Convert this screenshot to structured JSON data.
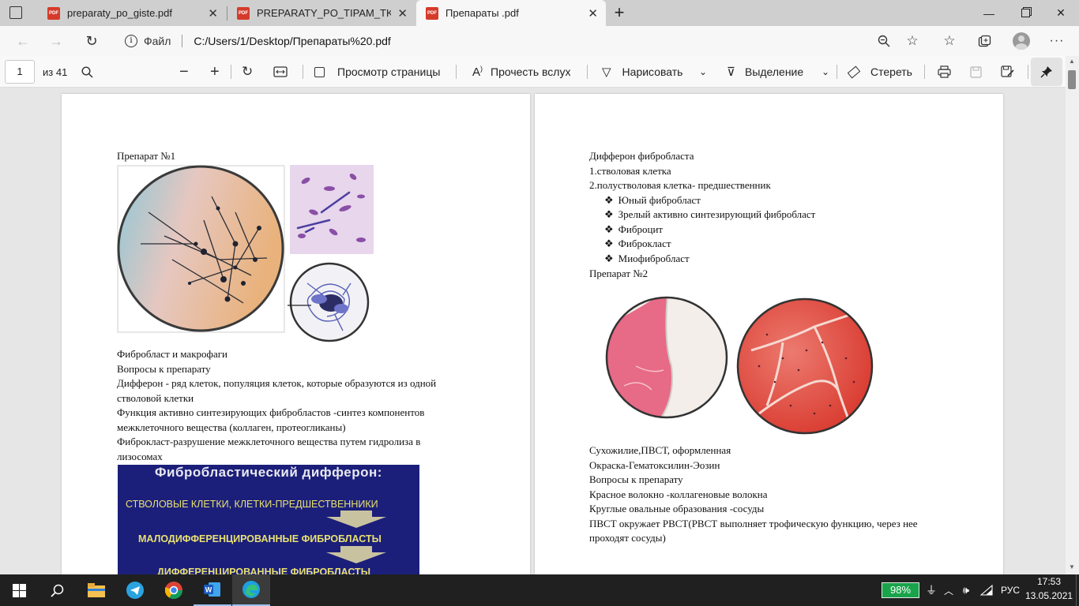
{
  "browser": {
    "tabs": [
      {
        "title": "preparaty_po_giste.pdf",
        "active": false
      },
      {
        "title": "PREPARATY_PO_TIPAM_TKANEJ (",
        "active": false
      },
      {
        "title": "Препараты .pdf",
        "active": true
      }
    ],
    "pdf_badge": "PDF",
    "new_tab": "+",
    "address": {
      "scheme_label": "Файл",
      "url": "C:/Users/1/Desktop/Препараты%20.pdf"
    }
  },
  "pdf_toolbar": {
    "page_current": "1",
    "page_total": "из 41",
    "page_view": "Просмотр страницы",
    "read_aloud": "Прочесть вслух",
    "draw": "Нарисовать",
    "highlight": "Выделение",
    "erase": "Стереть"
  },
  "left_page": {
    "heading": "Препарат №1",
    "caption": "Фибробласт и макрофаги",
    "lines": [
      "Вопросы к препарату",
      "Дифферон - ряд клеток, популяция клеток, которые образуются из одной",
      "стволовой клетки",
      "Функция активно синтезирующих фибробластов -синтез компонентов",
      "межклеточного вещества (коллаген, протеогликаны)",
      "Фиброкласт-разрушение межклеточного вещества путем гидролиза в",
      "лизосомах"
    ],
    "slide": {
      "title": "Фибробластический  дифферон:",
      "row1": "СТВОЛОВЫЕ КЛЕТКИ, КЛЕТКИ-ПРЕДШЕСТВЕННИКИ",
      "row2": "МАЛОДИФФЕРЕНЦИРОВАННЫЕ  ФИБРОБЛАСТЫ",
      "row3": "ДИФФЕРЕНЦИРОВАННЫЕ ФИБРОБЛАСТЫ"
    }
  },
  "right_page": {
    "lines_top": [
      "Дифферон фибробласта",
      "1.стволовая клетка",
      "2.полустволовая клетка- предшественник"
    ],
    "bullet_glyph": "❖",
    "bullets": [
      "Юный фибробласт",
      "Зрелый активно синтезирующий фибробласт",
      "Фиброцит",
      "Фиброкласт",
      "Миофибробласт"
    ],
    "heading2": "Препарат №2",
    "lines_bottom": [
      "Сухожилие,ПВСТ, оформленная",
      "Окраска-Гематоксилин-Эозин",
      "Вопросы к препарату",
      "Красное волокно -коллагеновые волокна",
      "Круглые овальные образования -сосуды",
      "ПВСТ окружает РВСТ(РВСТ выполняет трофическую функцию, через нее",
      "проходят сосуды)"
    ]
  },
  "taskbar": {
    "battery": "98%",
    "language": "РУС",
    "time": "17:53",
    "date": "13.05.2021"
  },
  "colors": {
    "tab_bar": "#cfcfcf",
    "active_tab": "#f7f7f7",
    "pdf_icon": "#d63a2a",
    "slide_bg": "#1b1f7a",
    "slide_title": "#e8e8f0",
    "slide_text": "#e8e070",
    "taskbar": "#202020",
    "battery_green": "#19a34a"
  }
}
